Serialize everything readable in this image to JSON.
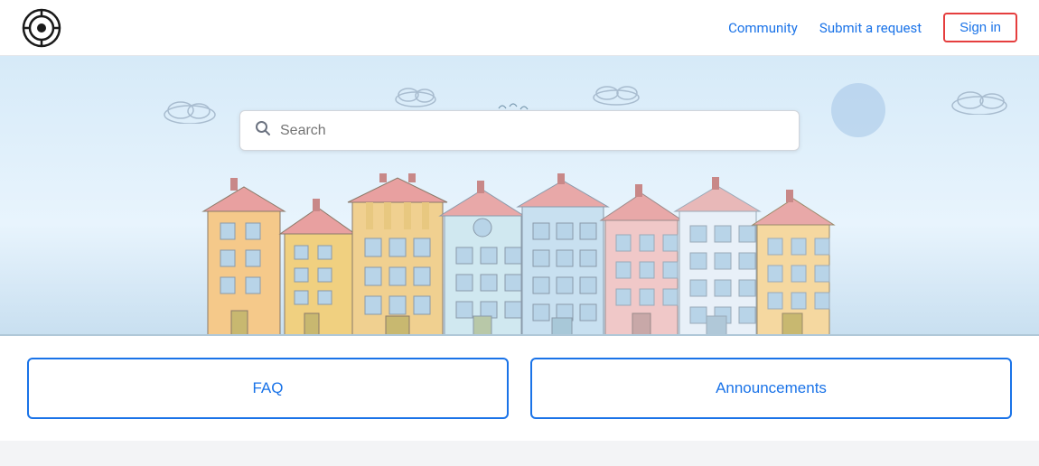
{
  "header": {
    "logo_alt": "Zendesk logo",
    "nav": {
      "community_label": "Community",
      "submit_label": "Submit a request",
      "signin_label": "Sign in"
    }
  },
  "hero": {
    "search_placeholder": "Search"
  },
  "cards": {
    "faq_label": "FAQ",
    "announcements_label": "Announcements"
  }
}
